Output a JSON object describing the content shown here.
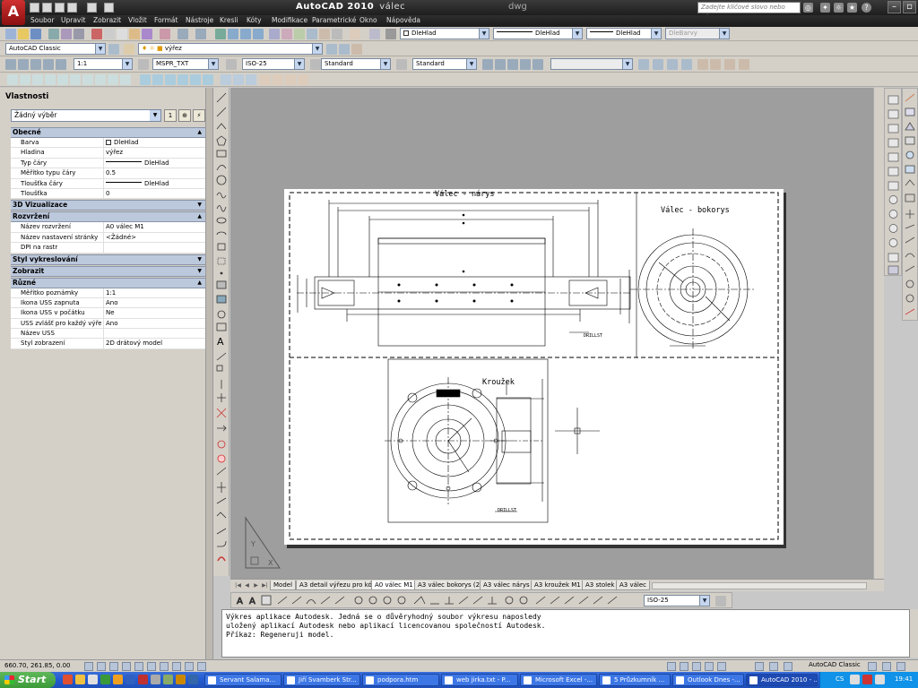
{
  "window": {
    "app_name": "AutoCAD 2010",
    "drawing_name": "válec",
    "drawing_ext": "dwg"
  },
  "help": {
    "search_placeholder": "Zadejte klíčové slovo nebo výraz."
  },
  "menu": [
    "Soubor",
    "Upravit",
    "Zobrazit",
    "Vložit",
    "Formát",
    "Nástroje",
    "Kresli",
    "Kóty",
    "Modifikace",
    "Parametrické",
    "Okno",
    "Nápověda"
  ],
  "toolbars": {
    "layer_color": "DleHlad",
    "linetype": "DleHlad",
    "lineweight": "DleHlad",
    "plot_style": "DleBarvy",
    "workspace": "AutoCAD Classic",
    "layer": "výřez",
    "scale": "1:1",
    "text_style": "MSPR_TXT",
    "dim_style": "ISO-25",
    "table_style": "Standard",
    "mleader_style": "Standard"
  },
  "properties": {
    "title": "Vlastnosti",
    "selection": "Žádný výběr",
    "sections": [
      {
        "name": "Obecné",
        "expanded": true,
        "rows": [
          {
            "key": "Barva",
            "value": "DleHlad",
            "glyph": "swatch"
          },
          {
            "key": "Hladina",
            "value": "výřez"
          },
          {
            "key": "Typ čáry",
            "value": "DleHlad",
            "glyph": "line"
          },
          {
            "key": "Měřítko typu čáry",
            "value": "0.5"
          },
          {
            "key": "Tloušťka čáry",
            "value": "DleHlad",
            "glyph": "line"
          },
          {
            "key": "Tloušťka",
            "value": "0"
          }
        ]
      },
      {
        "name": "3D Vizualizace",
        "expanded": false,
        "rows": []
      },
      {
        "name": "Rozvržení",
        "expanded": true,
        "rows": [
          {
            "key": "Název rozvržení",
            "value": "A0 válec M1"
          },
          {
            "key": "Název nastavení stránky",
            "value": "<Žádné>"
          },
          {
            "key": "DPI na rastr",
            "value": ""
          }
        ]
      },
      {
        "name": "Styl vykreslování",
        "expanded": false,
        "rows": []
      },
      {
        "name": "Zobrazit",
        "expanded": false,
        "rows": []
      },
      {
        "name": "Různé",
        "expanded": true,
        "rows": [
          {
            "key": "Měřítko poznámky",
            "value": "1:1"
          },
          {
            "key": "Ikona USS zapnuta",
            "value": "Ano"
          },
          {
            "key": "Ikona USS v počátku",
            "value": "Ne"
          },
          {
            "key": "USS zvlášť pro každý výřez",
            "value": "Ano"
          },
          {
            "key": "Název USS",
            "value": ""
          },
          {
            "key": "Styl zobrazení",
            "value": "2D drátový model"
          }
        ]
      }
    ]
  },
  "drawing": {
    "front_view_title": "Válec - nárys",
    "side_view_title": "Válec - bokorys",
    "ring_title": "Kroužek",
    "label_1": "DRILLST",
    "label_2": "DRILLST"
  },
  "tabs": [
    "Model",
    "A3 detail výřezu pro kóty",
    "A0 válec M1",
    "A3 válec bokorys (2)",
    "A3 válec nárys",
    "A3 kroužek M1",
    "A3 stolek",
    "A3 válec"
  ],
  "active_tab": "A0 válec M1",
  "dim_toolbar": {
    "dim_style": "ISO-25"
  },
  "command_lines": [
    "Výkres aplikace Autodesk. Jedná se o důvěryhodný soubor výkresu naposledy",
    "uložený aplikací Autodesk nebo aplikací licencovanou společností Autodesk.",
    "Příkaz: Regeneruji model."
  ],
  "status": {
    "coordinates": "660.70, 261.85, 0.00",
    "workspace": "AutoCAD Classic"
  },
  "taskbar": {
    "start": "Start",
    "tasks": [
      "Servant Salama...",
      "Jiří Svamberk Str...",
      "podpora.htm",
      "web jirka.txt - P...",
      "Microsoft Excel -...",
      "5 Průzkumník ...",
      "Outlook Dnes -...",
      "AutoCAD 2010 - ..."
    ],
    "language": "CS",
    "clock": "19:41"
  }
}
